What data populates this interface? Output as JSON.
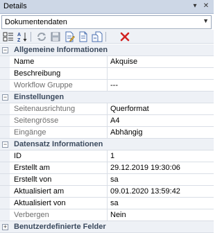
{
  "panel": {
    "title": "Details"
  },
  "selector": {
    "selected": "Dokumentendaten"
  },
  "sections": {
    "allgemein": {
      "label": "Allgemeine Informationen",
      "rows": {
        "name": {
          "label": "Name",
          "value": "Akquise"
        },
        "beschreibung": {
          "label": "Beschreibung",
          "value": ""
        },
        "workflow": {
          "label": "Workflow Gruppe",
          "value": "---"
        }
      }
    },
    "einstellungen": {
      "label": "Einstellungen",
      "rows": {
        "ausrichtung": {
          "label": "Seitenausrichtung",
          "value": "Querformat"
        },
        "groesse": {
          "label": "Seitengrösse",
          "value": "A4"
        },
        "eingaenge": {
          "label": "Eingänge",
          "value": "Abhängig"
        }
      }
    },
    "datensatz": {
      "label": "Datensatz Informationen",
      "rows": {
        "id": {
          "label": "ID",
          "value": "1"
        },
        "erstellt_am": {
          "label": "Erstellt am",
          "value": "29.12.2019 19:30:06"
        },
        "erstellt_von": {
          "label": "Erstellt von",
          "value": "sa"
        },
        "aktualisiert_am": {
          "label": "Aktualisiert am",
          "value": "09.01.2020 13:59:42"
        },
        "aktualisiert_von": {
          "label": "Aktualisiert von",
          "value": "sa"
        },
        "verbergen": {
          "label": "Verbergen",
          "value": "Nein"
        }
      }
    },
    "benutzer": {
      "label": "Benutzerdefinierte Felder"
    }
  },
  "colors": {
    "category_text": "#3b4a5e",
    "muted_text": "#6e6e6e",
    "delete_red": "#d22222"
  }
}
